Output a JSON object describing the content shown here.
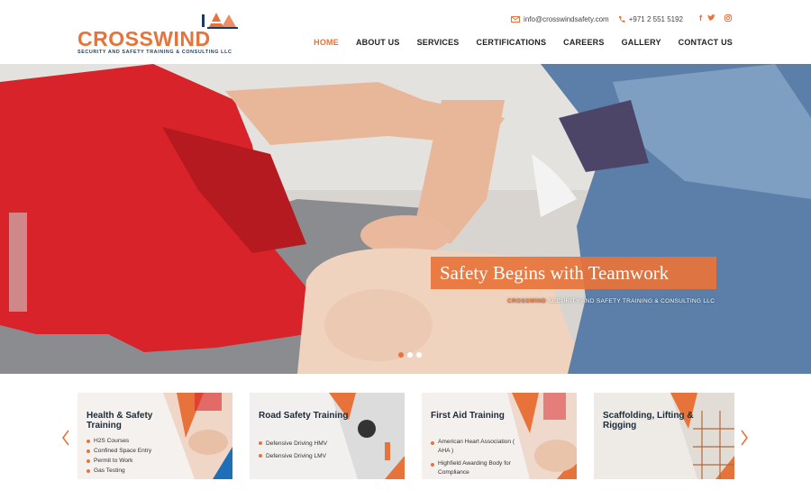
{
  "brand": {
    "name": "CROSSWIND",
    "tagline": "SECURITY AND SAFETY TRAINING & CONSULTING LLC"
  },
  "contact": {
    "email": "info@crosswindsafety.com",
    "phone": "+971 2 551 5192",
    "icons": [
      "envelope-icon",
      "phone-icon",
      "facebook-icon",
      "twitter-icon",
      "instagram-icon"
    ]
  },
  "nav": {
    "items": [
      "HOME",
      "ABOUT US",
      "SERVICES",
      "CERTIFICATIONS",
      "CAREERS",
      "GALLERY",
      "CONTACT US"
    ],
    "active": "HOME"
  },
  "hero": {
    "title": "Safety Begins with Teamwork",
    "subtitle_brand": "CROSSWIND",
    "subtitle_rest": " SECURITY AND SAFETY TRAINING & CONSULTING LLC",
    "slide_count": 3,
    "active_slide": 1
  },
  "cards": [
    {
      "title": "Health & Safety Training",
      "items": [
        "H2S Courses",
        "Confined Space Entry",
        "Permit to Work",
        "Gas Testing"
      ]
    },
    {
      "title": "Road Safety Training",
      "items": [
        "Defensive Driving HMV",
        "Defensive Driving LMV"
      ]
    },
    {
      "title": "First Aid Training",
      "items": [
        "American Heart Association ( AHA )",
        "Highfield Awarding Body for Compliance"
      ]
    },
    {
      "title": "Scaffolding, Lifting & Rigging",
      "items": []
    }
  ],
  "colors": {
    "accent": "#e8733a",
    "navy": "#1c3b5e",
    "text": "#222222"
  }
}
